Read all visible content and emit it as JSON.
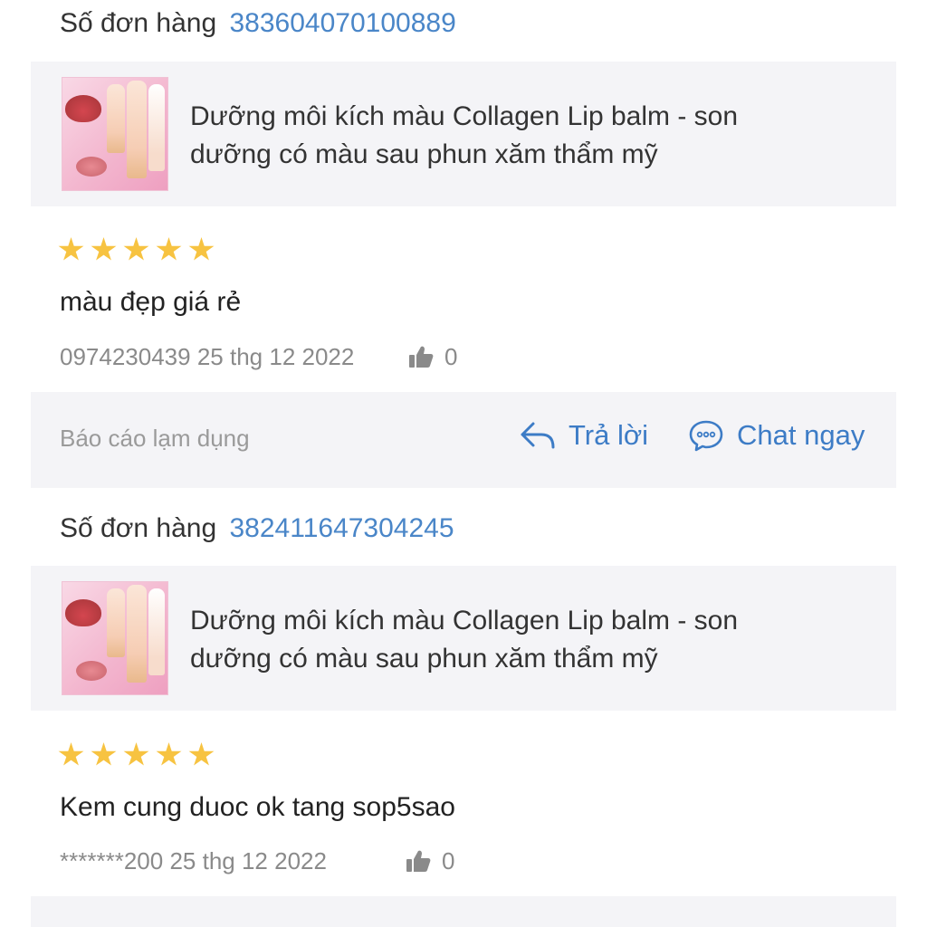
{
  "reviews": [
    {
      "order_label": "Số đơn hàng",
      "order_number": "383604070100889",
      "product_title": "Dưỡng môi kích màu Collagen Lip balm - son dưỡng có màu sau phun xăm thẩm mỹ",
      "rating": 5,
      "comment": "màu đẹp giá rẻ",
      "user": "0974230439",
      "date": "25 thg 12 2022",
      "likes": "0"
    },
    {
      "order_label": "Số đơn hàng",
      "order_number": "382411647304245",
      "product_title": "Dưỡng môi kích màu Collagen Lip balm - son dưỡng có màu sau phun xăm thẩm mỹ",
      "rating": 5,
      "comment": "Kem cung duoc ok tang sop5sao",
      "user": "*******200",
      "date": "25 thg 12 2022",
      "likes": "0"
    }
  ],
  "actions": {
    "report_label": "Báo cáo lạm dụng",
    "reply_label": "Trả lời",
    "chat_label": "Chat ngay"
  },
  "icons": {
    "star": "star-icon",
    "like": "thumbs-up-icon",
    "reply": "reply-arrow-icon",
    "chat": "chat-bubble-icon"
  },
  "colors": {
    "accent": "#3d7cc6",
    "order_number": "#4a86c8",
    "star": "#f7c341",
    "muted_text": "#8a8a8a",
    "card_bg": "#f4f4f7"
  }
}
